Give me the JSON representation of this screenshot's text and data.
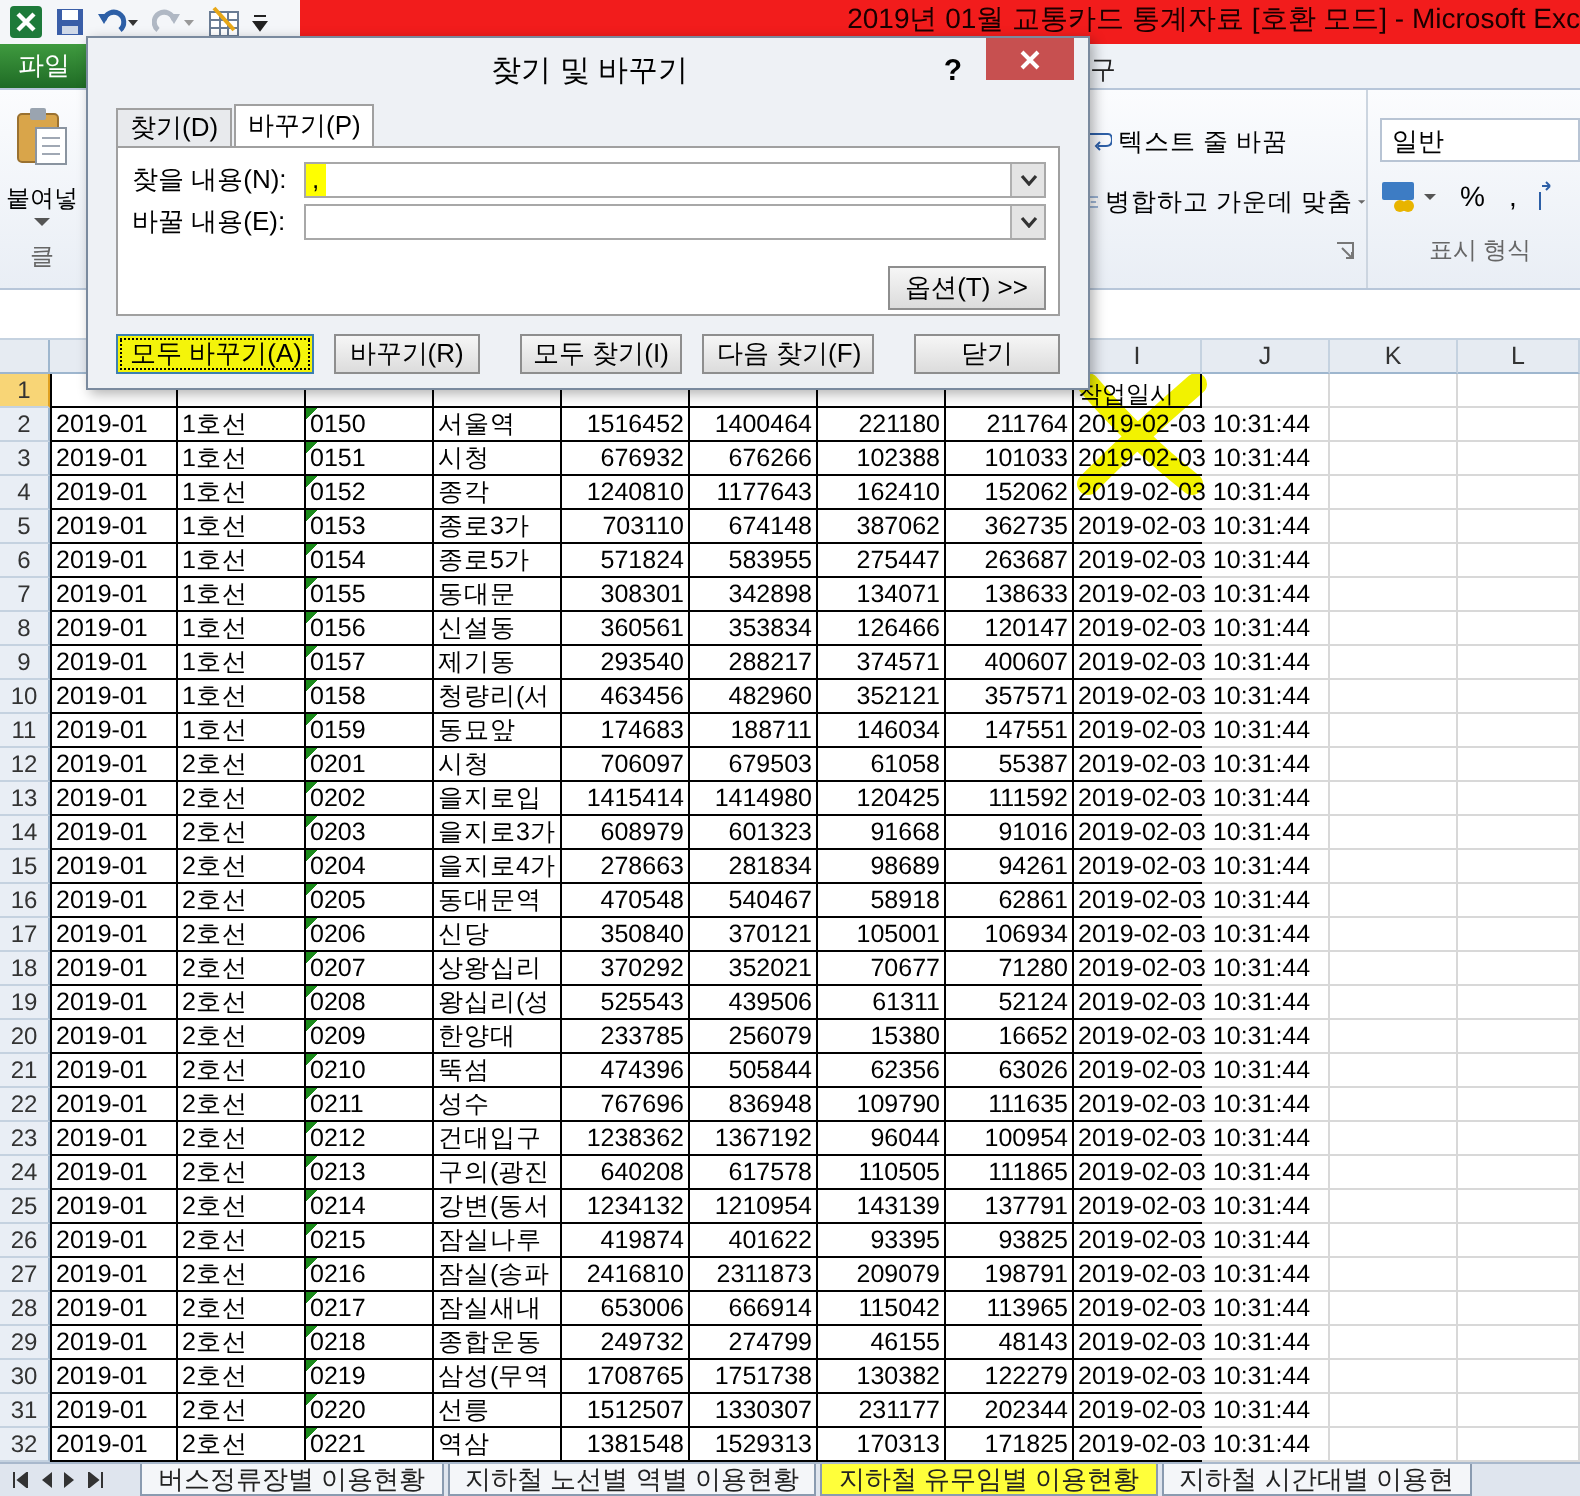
{
  "window": {
    "title": "2019년 01월  교통카드 통계자료  [호환 모드]  -  Microsoft Exc"
  },
  "ribbon": {
    "file_tab": "파일",
    "tabs": [
      {
        "label": "구"
      }
    ],
    "paste_label": "붙여넣",
    "clipboard_group": "클",
    "wrap_text": "텍스트 줄 바꿈",
    "merge_center": "병합하고 가운데 맞춤",
    "number_format": "일반",
    "percent": "%",
    "comma": ",",
    "number_group": "표시 형식"
  },
  "dialog": {
    "title": "찾기 및 바꾸기",
    "help": "?",
    "tabs": [
      {
        "label": "찾기(D)",
        "selected": false
      },
      {
        "label": "바꾸기(P)",
        "selected": true
      }
    ],
    "find": {
      "label": "찾을 내용(N):",
      "value": ",",
      "highlighted": true
    },
    "replace": {
      "label": "바꿀 내용(E):"
    },
    "options_button": "옵션(T) >>",
    "buttons": [
      {
        "label": "모두 바꾸기(A)",
        "highlighted": true
      },
      {
        "label": "바꾸기(R)",
        "highlighted": false
      },
      {
        "label": "모두 찾기(I)",
        "highlighted": false
      },
      {
        "label": "다음 찾기(F)",
        "highlighted": false
      },
      {
        "label": "닫기",
        "highlighted": false
      }
    ]
  },
  "sheet": {
    "column_headers": [
      "I",
      "J",
      "K",
      "L"
    ],
    "header_row": {
      "number": "1",
      "selected": true,
      "label": "작업일시"
    },
    "rows": [
      {
        "number": "2",
        "selected": false,
        "cells": [
          "2019-01",
          "1호선",
          "0150",
          "서울역",
          "1516452",
          "1400464",
          "221180",
          "211764",
          "2019-02-03 10:31:44"
        ]
      },
      {
        "number": "3",
        "selected": false,
        "cells": [
          "2019-01",
          "1호선",
          "0151",
          "시청",
          "676932",
          "676266",
          "102388",
          "101033",
          "2019-02-03 10:31:44"
        ]
      },
      {
        "number": "4",
        "selected": false,
        "cells": [
          "2019-01",
          "1호선",
          "0152",
          "종각",
          "1240810",
          "1177643",
          "162410",
          "152062",
          "2019-02-03 10:31:44"
        ]
      },
      {
        "number": "5",
        "selected": false,
        "cells": [
          "2019-01",
          "1호선",
          "0153",
          "종로3가",
          "703110",
          "674148",
          "387062",
          "362735",
          "2019-02-03 10:31:44"
        ]
      },
      {
        "number": "6",
        "selected": false,
        "cells": [
          "2019-01",
          "1호선",
          "0154",
          "종로5가",
          "571824",
          "583955",
          "275447",
          "263687",
          "2019-02-03 10:31:44"
        ]
      },
      {
        "number": "7",
        "selected": false,
        "cells": [
          "2019-01",
          "1호선",
          "0155",
          "동대문",
          "308301",
          "342898",
          "134071",
          "138633",
          "2019-02-03 10:31:44"
        ]
      },
      {
        "number": "8",
        "selected": false,
        "cells": [
          "2019-01",
          "1호선",
          "0156",
          "신설동",
          "360561",
          "353834",
          "126466",
          "120147",
          "2019-02-03 10:31:44"
        ]
      },
      {
        "number": "9",
        "selected": false,
        "cells": [
          "2019-01",
          "1호선",
          "0157",
          "제기동",
          "293540",
          "288217",
          "374571",
          "400607",
          "2019-02-03 10:31:44"
        ]
      },
      {
        "number": "10",
        "selected": false,
        "cells": [
          "2019-01",
          "1호선",
          "0158",
          "청량리(서",
          "463456",
          "482960",
          "352121",
          "357571",
          "2019-02-03 10:31:44"
        ]
      },
      {
        "number": "11",
        "selected": false,
        "cells": [
          "2019-01",
          "1호선",
          "0159",
          "동묘앞",
          "174683",
          "188711",
          "146034",
          "147551",
          "2019-02-03 10:31:44"
        ]
      },
      {
        "number": "12",
        "selected": false,
        "cells": [
          "2019-01",
          "2호선",
          "0201",
          "시청",
          "706097",
          "679503",
          "61058",
          "55387",
          "2019-02-03 10:31:44"
        ]
      },
      {
        "number": "13",
        "selected": false,
        "cells": [
          "2019-01",
          "2호선",
          "0202",
          "을지로입",
          "1415414",
          "1414980",
          "120425",
          "111592",
          "2019-02-03 10:31:44"
        ]
      },
      {
        "number": "14",
        "selected": false,
        "cells": [
          "2019-01",
          "2호선",
          "0203",
          "을지로3가",
          "608979",
          "601323",
          "91668",
          "91016",
          "2019-02-03 10:31:44"
        ]
      },
      {
        "number": "15",
        "selected": false,
        "cells": [
          "2019-01",
          "2호선",
          "0204",
          "을지로4가",
          "278663",
          "281834",
          "98689",
          "94261",
          "2019-02-03 10:31:44"
        ]
      },
      {
        "number": "16",
        "selected": false,
        "cells": [
          "2019-01",
          "2호선",
          "0205",
          "동대문역",
          "470548",
          "540467",
          "58918",
          "62861",
          "2019-02-03 10:31:44"
        ]
      },
      {
        "number": "17",
        "selected": false,
        "cells": [
          "2019-01",
          "2호선",
          "0206",
          "신당",
          "350840",
          "370121",
          "105001",
          "106934",
          "2019-02-03 10:31:44"
        ]
      },
      {
        "number": "18",
        "selected": false,
        "cells": [
          "2019-01",
          "2호선",
          "0207",
          "상왕십리",
          "370292",
          "352021",
          "70677",
          "71280",
          "2019-02-03 10:31:44"
        ]
      },
      {
        "number": "19",
        "selected": false,
        "cells": [
          "2019-01",
          "2호선",
          "0208",
          "왕십리(성",
          "525543",
          "439506",
          "61311",
          "52124",
          "2019-02-03 10:31:44"
        ]
      },
      {
        "number": "20",
        "selected": false,
        "cells": [
          "2019-01",
          "2호선",
          "0209",
          "한양대",
          "233785",
          "256079",
          "15380",
          "16652",
          "2019-02-03 10:31:44"
        ]
      },
      {
        "number": "21",
        "selected": false,
        "cells": [
          "2019-01",
          "2호선",
          "0210",
          "뚝섬",
          "474396",
          "505844",
          "62356",
          "63026",
          "2019-02-03 10:31:44"
        ]
      },
      {
        "number": "22",
        "selected": false,
        "cells": [
          "2019-01",
          "2호선",
          "0211",
          "성수",
          "767696",
          "836948",
          "109790",
          "111635",
          "2019-02-03 10:31:44"
        ]
      },
      {
        "number": "23",
        "selected": false,
        "cells": [
          "2019-01",
          "2호선",
          "0212",
          "건대입구",
          "1238362",
          "1367192",
          "96044",
          "100954",
          "2019-02-03 10:31:44"
        ]
      },
      {
        "number": "24",
        "selected": false,
        "cells": [
          "2019-01",
          "2호선",
          "0213",
          "구의(광진",
          "640208",
          "617578",
          "110505",
          "111865",
          "2019-02-03 10:31:44"
        ]
      },
      {
        "number": "25",
        "selected": false,
        "cells": [
          "2019-01",
          "2호선",
          "0214",
          "강변(동서",
          "1234132",
          "1210954",
          "143139",
          "137791",
          "2019-02-03 10:31:44"
        ]
      },
      {
        "number": "26",
        "selected": false,
        "cells": [
          "2019-01",
          "2호선",
          "0215",
          "잠실나루",
          "419874",
          "401622",
          "93395",
          "93825",
          "2019-02-03 10:31:44"
        ]
      },
      {
        "number": "27",
        "selected": false,
        "cells": [
          "2019-01",
          "2호선",
          "0216",
          "잠실(송파",
          "2416810",
          "2311873",
          "209079",
          "198791",
          "2019-02-03 10:31:44"
        ]
      },
      {
        "number": "28",
        "selected": false,
        "cells": [
          "2019-01",
          "2호선",
          "0217",
          "잠실새내",
          "653006",
          "666914",
          "115042",
          "113965",
          "2019-02-03 10:31:44"
        ]
      },
      {
        "number": "29",
        "selected": false,
        "cells": [
          "2019-01",
          "2호선",
          "0218",
          "종합운동",
          "249732",
          "274799",
          "46155",
          "48143",
          "2019-02-03 10:31:44"
        ]
      },
      {
        "number": "30",
        "selected": false,
        "cells": [
          "2019-01",
          "2호선",
          "0219",
          "삼성(무역",
          "1708765",
          "1751738",
          "130382",
          "122279",
          "2019-02-03 10:31:44"
        ]
      },
      {
        "number": "31",
        "selected": false,
        "cells": [
          "2019-01",
          "2호선",
          "0220",
          "선릉",
          "1512507",
          "1330307",
          "231177",
          "202344",
          "2019-02-03 10:31:44"
        ]
      },
      {
        "number": "32",
        "selected": false,
        "cells": [
          "2019-01",
          "2호선",
          "0221",
          "역삼",
          "1381548",
          "1529313",
          "170313",
          "171825",
          "2019-02-03 10:31:44"
        ]
      }
    ]
  },
  "sheet_tabs": [
    {
      "label": "버스정류장별 이용현황",
      "selected": false
    },
    {
      "label": "지하철 노선별 역별 이용현황",
      "selected": false
    },
    {
      "label": "지하철 유무임별 이용현황",
      "selected": true
    },
    {
      "label": "지하철 시간대별 이용현",
      "selected": false
    }
  ]
}
